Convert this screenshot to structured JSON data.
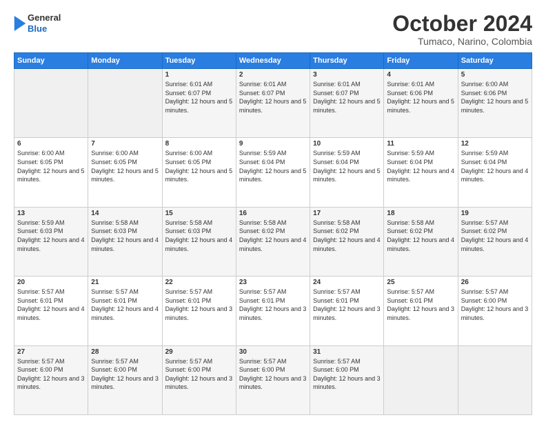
{
  "header": {
    "logo_general": "General",
    "logo_blue": "Blue",
    "month_title": "October 2024",
    "location": "Tumaco, Narino, Colombia"
  },
  "weekdays": [
    "Sunday",
    "Monday",
    "Tuesday",
    "Wednesday",
    "Thursday",
    "Friday",
    "Saturday"
  ],
  "weeks": [
    [
      {
        "day": "",
        "empty": true
      },
      {
        "day": "",
        "empty": true
      },
      {
        "day": "1",
        "sunrise": "6:01 AM",
        "sunset": "6:07 PM",
        "daylight": "12 hours and 5 minutes."
      },
      {
        "day": "2",
        "sunrise": "6:01 AM",
        "sunset": "6:07 PM",
        "daylight": "12 hours and 5 minutes."
      },
      {
        "day": "3",
        "sunrise": "6:01 AM",
        "sunset": "6:07 PM",
        "daylight": "12 hours and 5 minutes."
      },
      {
        "day": "4",
        "sunrise": "6:01 AM",
        "sunset": "6:06 PM",
        "daylight": "12 hours and 5 minutes."
      },
      {
        "day": "5",
        "sunrise": "6:00 AM",
        "sunset": "6:06 PM",
        "daylight": "12 hours and 5 minutes."
      }
    ],
    [
      {
        "day": "6",
        "sunrise": "6:00 AM",
        "sunset": "6:05 PM",
        "daylight": "12 hours and 5 minutes."
      },
      {
        "day": "7",
        "sunrise": "6:00 AM",
        "sunset": "6:05 PM",
        "daylight": "12 hours and 5 minutes."
      },
      {
        "day": "8",
        "sunrise": "6:00 AM",
        "sunset": "6:05 PM",
        "daylight": "12 hours and 5 minutes."
      },
      {
        "day": "9",
        "sunrise": "5:59 AM",
        "sunset": "6:04 PM",
        "daylight": "12 hours and 5 minutes."
      },
      {
        "day": "10",
        "sunrise": "5:59 AM",
        "sunset": "6:04 PM",
        "daylight": "12 hours and 5 minutes."
      },
      {
        "day": "11",
        "sunrise": "5:59 AM",
        "sunset": "6:04 PM",
        "daylight": "12 hours and 4 minutes."
      },
      {
        "day": "12",
        "sunrise": "5:59 AM",
        "sunset": "6:04 PM",
        "daylight": "12 hours and 4 minutes."
      }
    ],
    [
      {
        "day": "13",
        "sunrise": "5:59 AM",
        "sunset": "6:03 PM",
        "daylight": "12 hours and 4 minutes."
      },
      {
        "day": "14",
        "sunrise": "5:58 AM",
        "sunset": "6:03 PM",
        "daylight": "12 hours and 4 minutes."
      },
      {
        "day": "15",
        "sunrise": "5:58 AM",
        "sunset": "6:03 PM",
        "daylight": "12 hours and 4 minutes."
      },
      {
        "day": "16",
        "sunrise": "5:58 AM",
        "sunset": "6:02 PM",
        "daylight": "12 hours and 4 minutes."
      },
      {
        "day": "17",
        "sunrise": "5:58 AM",
        "sunset": "6:02 PM",
        "daylight": "12 hours and 4 minutes."
      },
      {
        "day": "18",
        "sunrise": "5:58 AM",
        "sunset": "6:02 PM",
        "daylight": "12 hours and 4 minutes."
      },
      {
        "day": "19",
        "sunrise": "5:57 AM",
        "sunset": "6:02 PM",
        "daylight": "12 hours and 4 minutes."
      }
    ],
    [
      {
        "day": "20",
        "sunrise": "5:57 AM",
        "sunset": "6:01 PM",
        "daylight": "12 hours and 4 minutes."
      },
      {
        "day": "21",
        "sunrise": "5:57 AM",
        "sunset": "6:01 PM",
        "daylight": "12 hours and 4 minutes."
      },
      {
        "day": "22",
        "sunrise": "5:57 AM",
        "sunset": "6:01 PM",
        "daylight": "12 hours and 3 minutes."
      },
      {
        "day": "23",
        "sunrise": "5:57 AM",
        "sunset": "6:01 PM",
        "daylight": "12 hours and 3 minutes."
      },
      {
        "day": "24",
        "sunrise": "5:57 AM",
        "sunset": "6:01 PM",
        "daylight": "12 hours and 3 minutes."
      },
      {
        "day": "25",
        "sunrise": "5:57 AM",
        "sunset": "6:01 PM",
        "daylight": "12 hours and 3 minutes."
      },
      {
        "day": "26",
        "sunrise": "5:57 AM",
        "sunset": "6:00 PM",
        "daylight": "12 hours and 3 minutes."
      }
    ],
    [
      {
        "day": "27",
        "sunrise": "5:57 AM",
        "sunset": "6:00 PM",
        "daylight": "12 hours and 3 minutes."
      },
      {
        "day": "28",
        "sunrise": "5:57 AM",
        "sunset": "6:00 PM",
        "daylight": "12 hours and 3 minutes."
      },
      {
        "day": "29",
        "sunrise": "5:57 AM",
        "sunset": "6:00 PM",
        "daylight": "12 hours and 3 minutes."
      },
      {
        "day": "30",
        "sunrise": "5:57 AM",
        "sunset": "6:00 PM",
        "daylight": "12 hours and 3 minutes."
      },
      {
        "day": "31",
        "sunrise": "5:57 AM",
        "sunset": "6:00 PM",
        "daylight": "12 hours and 3 minutes."
      },
      {
        "day": "",
        "empty": true
      },
      {
        "day": "",
        "empty": true
      }
    ]
  ],
  "labels": {
    "sunrise_prefix": "Sunrise: ",
    "sunset_prefix": "Sunset: ",
    "daylight_prefix": "Daylight: "
  }
}
